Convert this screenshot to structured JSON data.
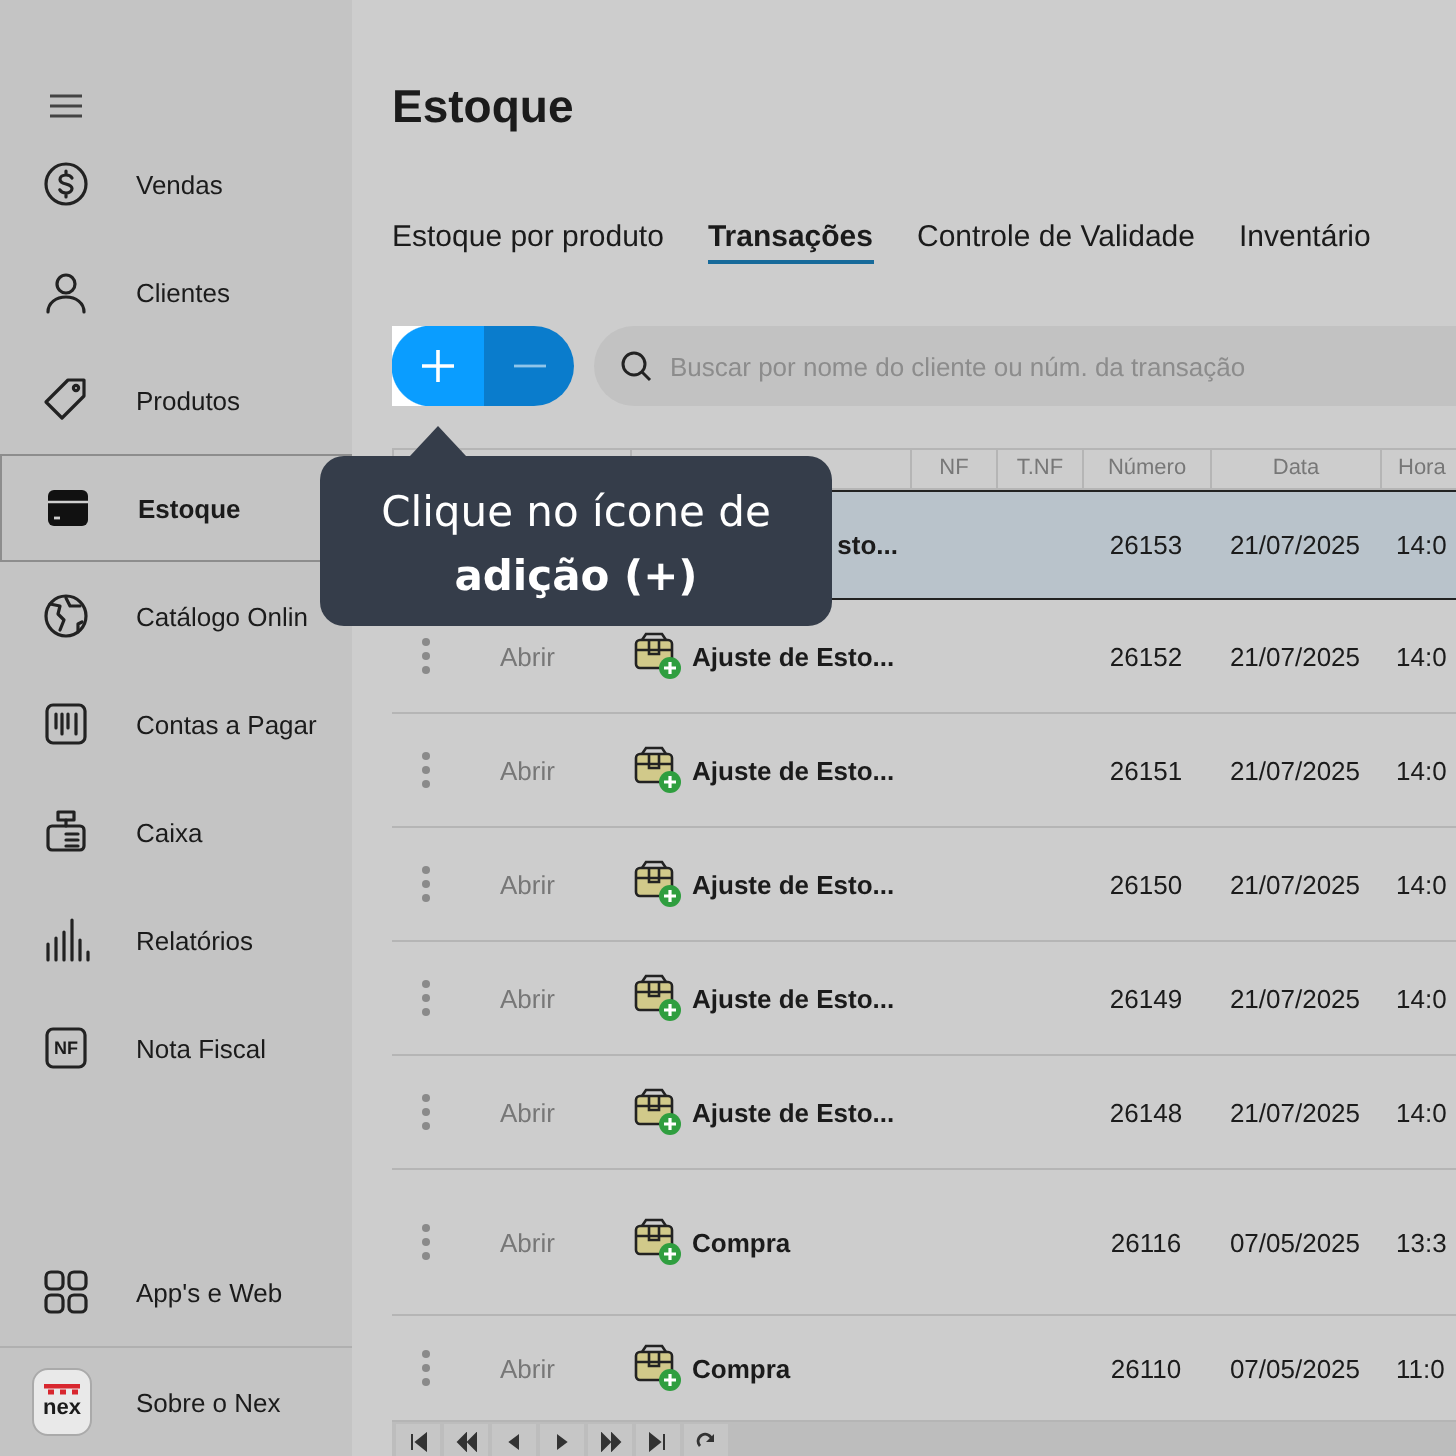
{
  "sidebar": {
    "items": [
      {
        "label": "Vendas",
        "selected": false
      },
      {
        "label": "Clientes",
        "selected": false
      },
      {
        "label": "Produtos",
        "selected": false
      },
      {
        "label": "Estoque",
        "selected": true
      },
      {
        "label": "Catálogo Onlin",
        "selected": false
      },
      {
        "label": "Contas a Pagar",
        "selected": false
      },
      {
        "label": "Caixa",
        "selected": false
      },
      {
        "label": "Relatórios",
        "selected": false
      },
      {
        "label": "Nota Fiscal",
        "selected": false,
        "icon_text": "NF"
      }
    ],
    "bottom_items": [
      {
        "label": "App's e Web"
      },
      {
        "label": "Sobre o Nex",
        "logo_text": "nex"
      }
    ]
  },
  "page": {
    "title": "Estoque",
    "tabs": [
      {
        "label": "Estoque por produto",
        "selected": false
      },
      {
        "label": "Transações",
        "selected": true
      },
      {
        "label": "Controle de Validade",
        "selected": false
      },
      {
        "label": "Inventário",
        "selected": false
      }
    ],
    "search": {
      "placeholder": "Buscar por nome do cliente ou núm. da transação"
    }
  },
  "table": {
    "columns": [
      "NF",
      "T.NF",
      "Número",
      "Data",
      "Hora"
    ],
    "rows": [
      {
        "kind": "covered",
        "selected": true,
        "type": "sto...",
        "number": "26153",
        "date": "21/07/2025",
        "time": "14:0"
      },
      {
        "kind": "full",
        "selected": false,
        "action": "Abrir",
        "type": "Ajuste de Esto...",
        "number": "26152",
        "date": "21/07/2025",
        "time": "14:0"
      },
      {
        "kind": "full",
        "selected": false,
        "action": "Abrir",
        "type": "Ajuste de Esto...",
        "number": "26151",
        "date": "21/07/2025",
        "time": "14:0"
      },
      {
        "kind": "full",
        "selected": false,
        "action": "Abrir",
        "type": "Ajuste de Esto...",
        "number": "26150",
        "date": "21/07/2025",
        "time": "14:0"
      },
      {
        "kind": "full",
        "selected": false,
        "action": "Abrir",
        "type": "Ajuste de Esto...",
        "number": "26149",
        "date": "21/07/2025",
        "time": "14:0"
      },
      {
        "kind": "full",
        "selected": false,
        "action": "Abrir",
        "type": "Ajuste de Esto...",
        "number": "26148",
        "date": "21/07/2025",
        "time": "14:0"
      },
      {
        "kind": "full",
        "selected": false,
        "action": "Abrir",
        "type": "Compra",
        "number": "26116",
        "date": "07/05/2025",
        "time": "13:3"
      },
      {
        "kind": "full",
        "selected": false,
        "action": "Abrir",
        "type": "Compra",
        "number": "26110",
        "date": "07/05/2025",
        "time": "11:0"
      }
    ]
  },
  "tooltip": {
    "text": "Clique no ícone de **adição (+)**"
  }
}
